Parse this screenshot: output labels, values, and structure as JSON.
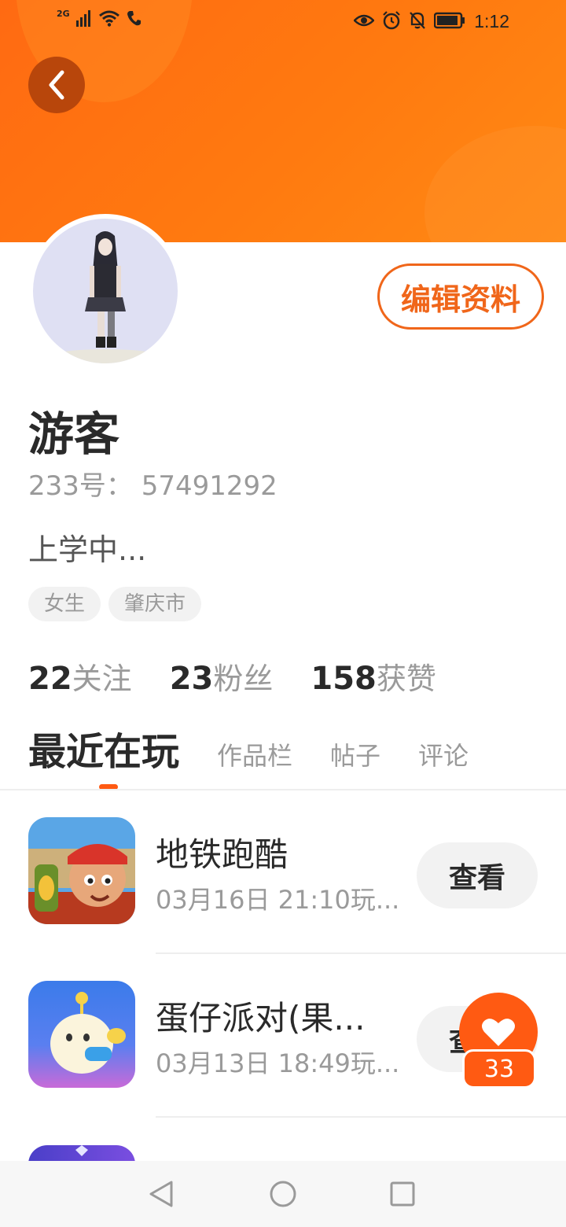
{
  "statusbar": {
    "network": "2G",
    "time": "1:12"
  },
  "profile": {
    "name": "游客",
    "uid": "233号： 57491292",
    "bio": "上学中...",
    "edit_label": "编辑资料",
    "tags": [
      "女生",
      "肇庆市"
    ]
  },
  "stats": [
    {
      "num": "22",
      "label": "关注"
    },
    {
      "num": "23",
      "label": "粉丝"
    },
    {
      "num": "158",
      "label": "获赞"
    }
  ],
  "tabs": [
    "最近在玩",
    "作品栏",
    "帖子",
    "评论"
  ],
  "games": [
    {
      "title": "地铁跑酷",
      "time": "03月16日 21:10玩...",
      "button": "查看"
    },
    {
      "title": "蛋仔派对(果...",
      "time": "03月13日 18:49玩...",
      "button": "查看"
    }
  ],
  "like_badge": {
    "count": "33"
  },
  "colors": {
    "accent": "#ff5a12",
    "banner": "#ff7410"
  }
}
